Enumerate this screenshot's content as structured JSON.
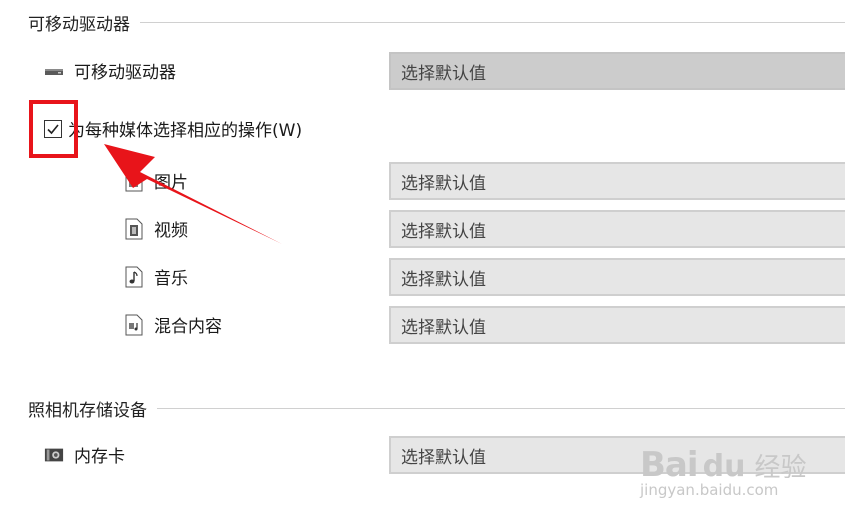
{
  "removable_section": {
    "title": "可移动驱动器",
    "drive_label": "可移动驱动器",
    "drive_value": "选择默认值"
  },
  "media_option": {
    "checkbox_label": "为每种媒体选择相应的操作(W)",
    "checked": true
  },
  "media_items": [
    {
      "label": "图片",
      "value": "选择默认值",
      "icon": "picture-file-icon"
    },
    {
      "label": "视频",
      "value": "选择默认值",
      "icon": "video-file-icon"
    },
    {
      "label": "音乐",
      "value": "选择默认值",
      "icon": "music-file-icon"
    },
    {
      "label": "混合内容",
      "value": "选择默认值",
      "icon": "mixed-content-file-icon"
    }
  ],
  "camera_section": {
    "title": "照相机存储设备",
    "card_label": "内存卡",
    "card_value": "选择默认值"
  },
  "watermark": {
    "brand": "Bai",
    "cn": "经验",
    "url": "jingyan.baidu.com"
  },
  "colors": {
    "highlight": "#e8141a",
    "dropdown_bg": "#e6e6e6"
  }
}
